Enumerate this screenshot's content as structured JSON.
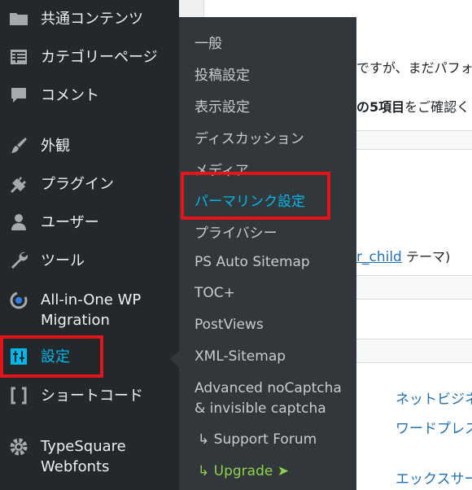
{
  "sidebar": {
    "items": [
      {
        "label": "共通コンテンツ",
        "icon": "folder-icon"
      },
      {
        "label": "カテゴリーページ",
        "icon": "table-icon"
      },
      {
        "label": "コメント",
        "icon": "comment-icon"
      },
      {
        "label": "外観",
        "icon": "brush-icon"
      },
      {
        "label": "プラグイン",
        "icon": "plug-icon"
      },
      {
        "label": "ユーザー",
        "icon": "user-icon"
      },
      {
        "label": "ツール",
        "icon": "wrench-icon"
      },
      {
        "label": "All-in-One WP Migration",
        "icon": "migration-icon"
      },
      {
        "label": "設定",
        "icon": "settings-icon"
      },
      {
        "label": "ショートコード",
        "icon": "shortcode-icon"
      },
      {
        "label": "TypeSquare Webfonts",
        "icon": "gear-icon"
      }
    ]
  },
  "submenu": {
    "items": [
      "一般",
      "投稿設定",
      "表示設定",
      "ディスカッション",
      "メディア",
      "パーマリンク設定",
      "プライバシー",
      "PS Auto Sitemap",
      "TOC+",
      "PostViews",
      "XML-Sitemap",
      "Advanced noCaptcha",
      "& invisible captcha",
      "↳ Support Forum",
      "↳ Upgrade ➤"
    ]
  },
  "main": {
    "line1_prefix": "ですが、まだパフォ",
    "line2_num": "の5項目",
    "line2_rest": "をご確認く",
    "theme_link": "r_child",
    "theme_suffix": " テーマ)",
    "links": [
      "ネットビジネ",
      "ワードプレス",
      "エックスサー"
    ]
  },
  "colors": {
    "highlight": "#e3141a",
    "active": "#00b9eb",
    "upgrade": "#8ed24c"
  }
}
